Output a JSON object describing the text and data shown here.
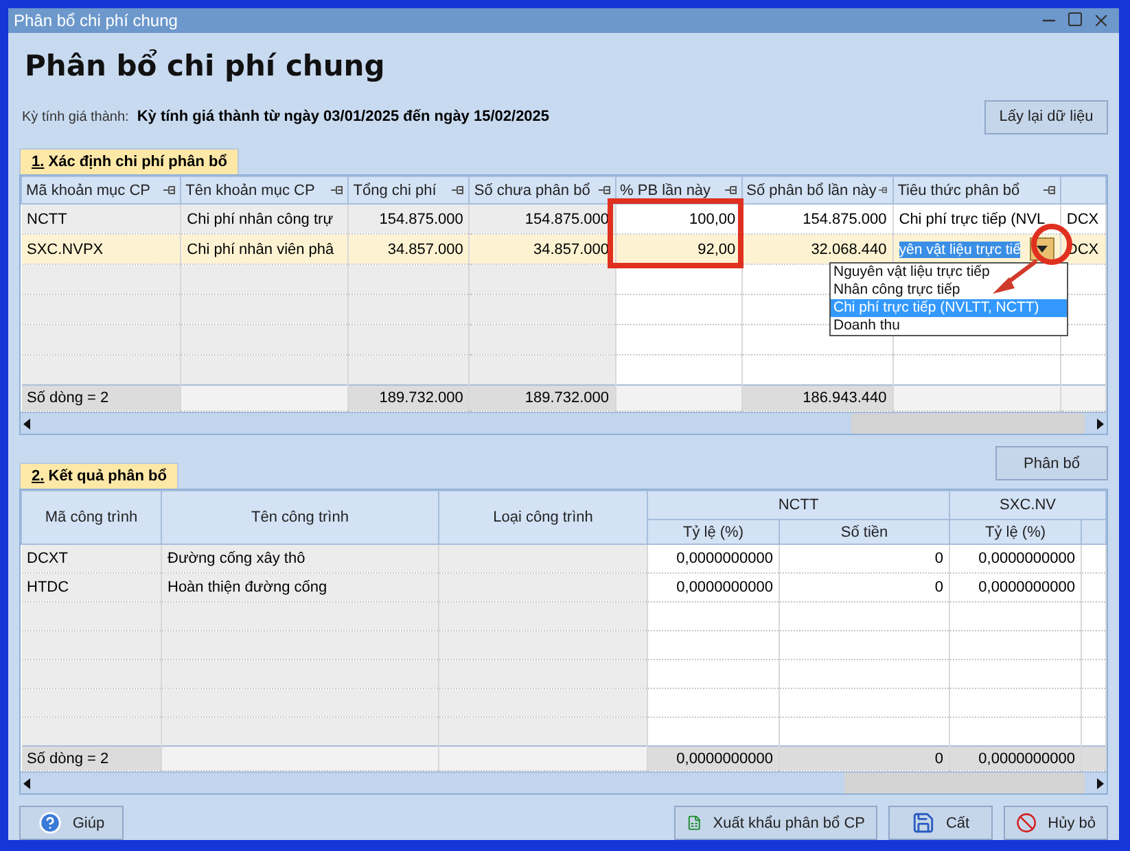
{
  "window": {
    "title": "Phân bổ chi phí chung"
  },
  "heading": "Phân bổ chi phí chung",
  "period": {
    "label": "Kỳ tính giá thành:",
    "value": "Kỳ tính giá thành từ ngày 03/01/2025 đến ngày 15/02/2025"
  },
  "reload_button": "Lấy lại dữ liệu",
  "section_1": {
    "tab": "1. Xác định chi phí phân bổ",
    "columns": [
      {
        "label": "Mã khoản mục CP",
        "kind": "text",
        "readonly": true
      },
      {
        "label": "Tên khoản mục CP",
        "kind": "text",
        "readonly": true
      },
      {
        "label": "Tổng chi phí",
        "kind": "number",
        "readonly": true,
        "total": "189.732.000"
      },
      {
        "label": "Số chưa phân bổ",
        "kind": "number",
        "readonly": true,
        "total": "189.732.000"
      },
      {
        "label": "% PB lần này",
        "kind": "number",
        "readonly": false
      },
      {
        "label": "Số phân bổ lần này",
        "kind": "number",
        "readonly": false,
        "total": "186.943.440"
      },
      {
        "label": "Tiêu thức phân bổ",
        "kind": "text",
        "readonly": false
      },
      {
        "kind": "text",
        "readonly": false
      }
    ],
    "rows": [
      {
        "selected": false,
        "cells": [
          "NCTT",
          "Chi phí nhân công trự",
          "154.875.000",
          "154.875.000",
          "100,00",
          "154.875.000",
          "Chi phí trực tiếp (NVL",
          "DCX"
        ]
      },
      {
        "selected": true,
        "cells": [
          "SXC.NVPX",
          "Chi phí nhân viên phâ",
          "34.857.000",
          "34.857.000",
          "92,00",
          "32.068.440",
          {
            "kind": "combo",
            "value": "yên vật liệu trực tiế"
          },
          "DCX"
        ]
      }
    ],
    "row_count": "Số dòng = 2",
    "dropdown": {
      "options": [
        {
          "label": "Nguyên vật liệu trực tiếp",
          "selected": false
        },
        {
          "label": "Nhân công trực tiếp",
          "selected": false
        },
        {
          "label": "Chi phí trực tiếp (NVLTT, NCTT)",
          "selected": true
        },
        {
          "label": "Doanh thu",
          "selected": false
        }
      ]
    }
  },
  "allocate_button": "Phân bổ",
  "section_2": {
    "tab": "2. Kết quả phân bổ",
    "fixed_columns": [
      {
        "label": "Mã công trình",
        "readonly": true
      },
      {
        "label": "Tên công trình",
        "readonly": true
      },
      {
        "label": "Loại công trình",
        "readonly": true
      }
    ],
    "groups": [
      {
        "label": "NCTT",
        "subcolumns": [
          {
            "label": "Tỷ lệ (%)",
            "total": "0,0000000000"
          },
          {
            "label": "Số tiền",
            "total": "0"
          }
        ]
      },
      {
        "label": "SXC.NV",
        "subcolumns": [
          {
            "label": "Tỷ lệ (%)",
            "total": "0,0000000000"
          }
        ]
      }
    ],
    "rows": [
      {
        "code": "DCXT",
        "name": "Đường cống xây thô",
        "values": [
          "0,0000000000",
          "0",
          "0,0000000000"
        ]
      },
      {
        "code": "HTDC",
        "name": "Hoàn thiện đường cống",
        "values": [
          "0,0000000000",
          "0",
          "0,0000000000"
        ]
      }
    ],
    "row_count": "Số dòng = 2"
  },
  "buttons": [
    {
      "label": "Giúp",
      "kind": "help"
    },
    {
      "label": "Xuất khẩu phân bổ CP",
      "kind": "export"
    },
    {
      "label": "Cất",
      "kind": "save"
    },
    {
      "label": "Hủy bỏ",
      "kind": "cancel"
    }
  ]
}
